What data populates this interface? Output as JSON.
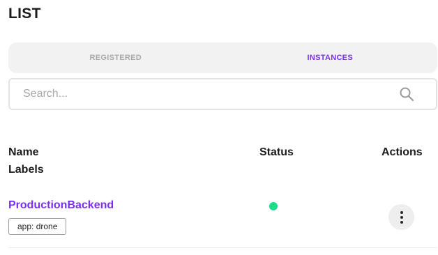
{
  "page": {
    "title": "LIST"
  },
  "tabs": [
    {
      "label": "REGISTERED",
      "active": false
    },
    {
      "label": "INSTANCES",
      "active": true
    }
  ],
  "search": {
    "placeholder": "Search...",
    "value": "",
    "icon": "search-icon"
  },
  "table": {
    "headers": {
      "name": "Name",
      "labels": "Labels",
      "status": "Status",
      "actions": "Actions"
    },
    "rows": [
      {
        "name": "ProductionBackend",
        "labels": [
          "app: drone"
        ],
        "status": "online",
        "actions_icon": "more-vertical-icon"
      }
    ]
  },
  "colors": {
    "accent": "#7b2ff2",
    "status_online": "#1fdc8a",
    "tab_inactive": "#a9a9a9"
  }
}
